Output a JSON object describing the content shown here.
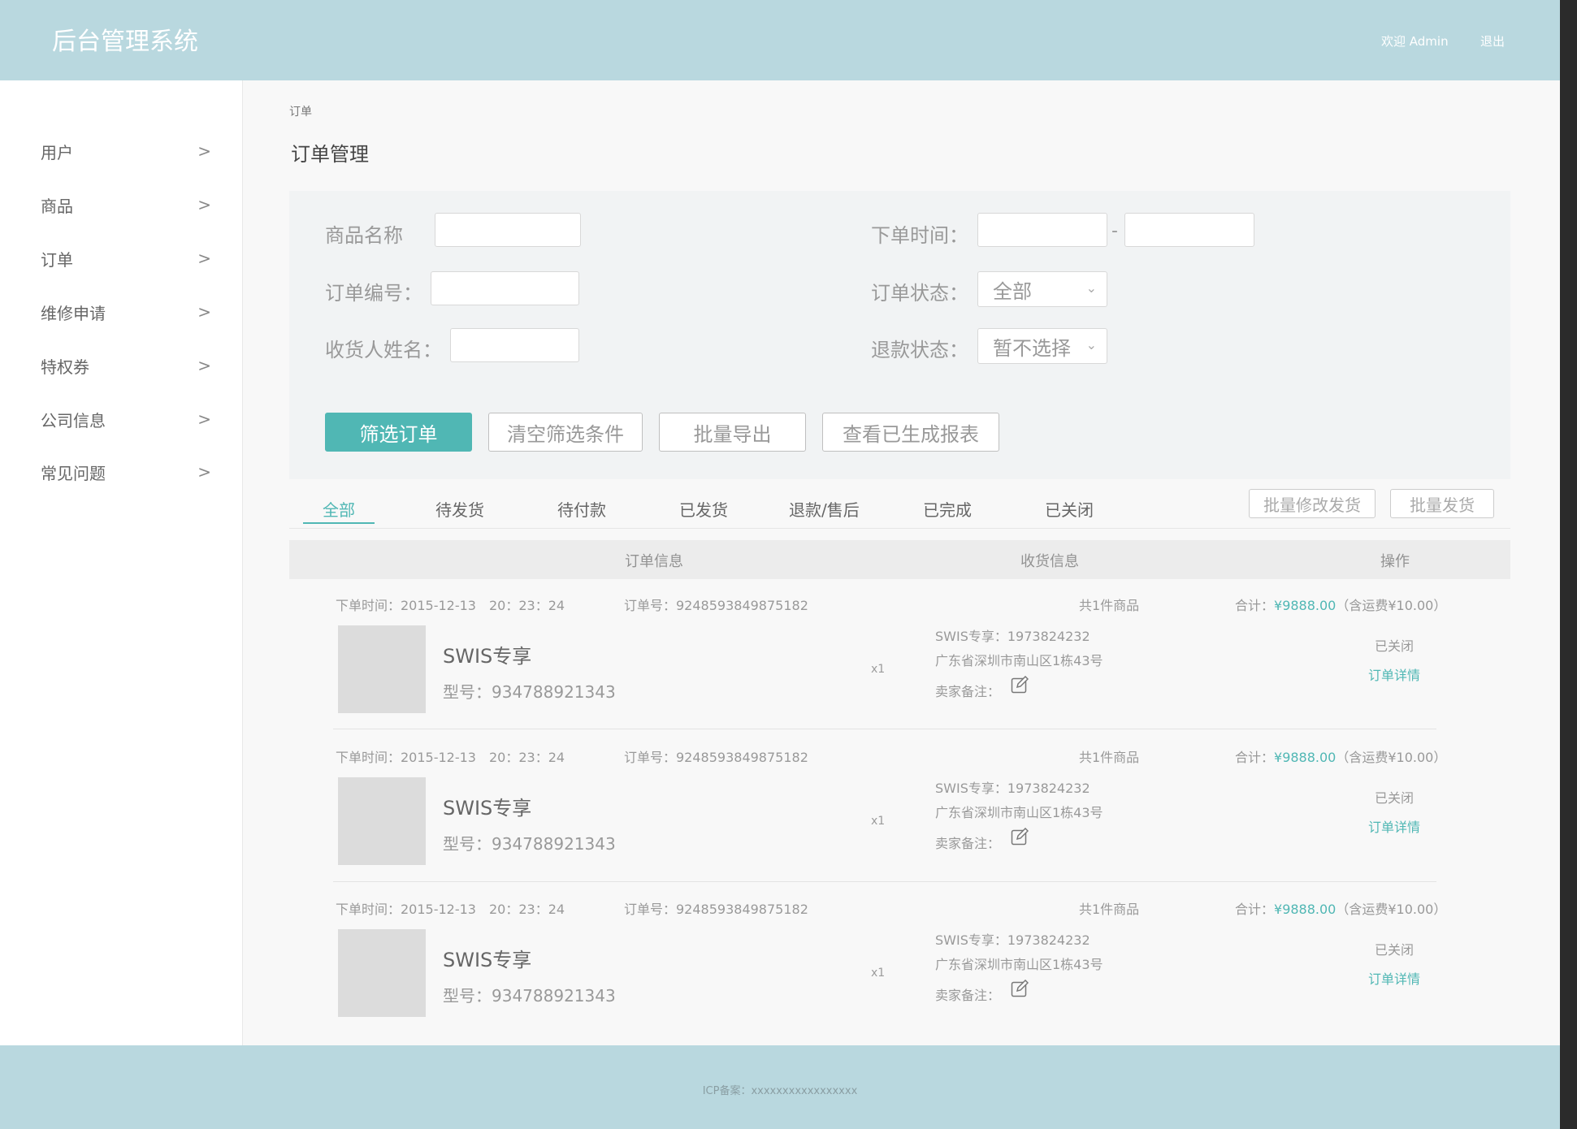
{
  "header": {
    "brand": "后台管理系统",
    "welcome": "欢迎 Admin",
    "logout": "退出"
  },
  "sidebar": {
    "items": [
      {
        "label": "用户"
      },
      {
        "label": "商品"
      },
      {
        "label": "订单"
      },
      {
        "label": "维修申请"
      },
      {
        "label": "特权券"
      },
      {
        "label": "公司信息"
      },
      {
        "label": "常见问题"
      }
    ],
    "chevron": ">"
  },
  "breadcrumb": "订单",
  "page_title": "订单管理",
  "filters": {
    "product_name_label": "商品名称",
    "order_time_label": "下单时间：",
    "date_separator": "-",
    "order_no_label": "订单编号：",
    "order_status_label": "订单状态：",
    "order_status_value": "全部",
    "receiver_label": "收货人姓名：",
    "refund_status_label": "退款状态：",
    "refund_status_value": "暂不选择"
  },
  "actions": {
    "filter": "筛选订单",
    "clear": "清空筛选条件",
    "export": "批量导出",
    "reports": "查看已生成报表"
  },
  "tabs": [
    "全部",
    "待发货",
    "待付款",
    "已发货",
    "退款/售后",
    "已完成",
    "已关闭"
  ],
  "tab_buttons": {
    "batch_modify": "批量修改发货",
    "batch_ship": "批量发货"
  },
  "table_header": {
    "info": "订单信息",
    "receiver": "收货信息",
    "action": "操作"
  },
  "orders": [
    {
      "time": "下单时间：2015-12-13　20：23：24",
      "order_no": "订单号：9248593849875182",
      "count": "共1件商品",
      "total_label": "合计：",
      "total": "¥9888.00",
      "shipping": "（含运费¥10.00）",
      "product": "SWIS专享",
      "model": "型号：934788921343",
      "qty": "x1",
      "receiver": "SWIS专享：1973824232",
      "address": "广东省深圳市南山区1栋43号",
      "remark": "卖家备注：",
      "status": "已关闭",
      "detail": "订单详情"
    },
    {
      "time": "下单时间：2015-12-13　20：23：24",
      "order_no": "订单号：9248593849875182",
      "count": "共1件商品",
      "total_label": "合计：",
      "total": "¥9888.00",
      "shipping": "（含运费¥10.00）",
      "product": "SWIS专享",
      "model": "型号：934788921343",
      "qty": "x1",
      "receiver": "SWIS专享：1973824232",
      "address": "广东省深圳市南山区1栋43号",
      "remark": "卖家备注：",
      "status": "已关闭",
      "detail": "订单详情"
    },
    {
      "time": "下单时间：2015-12-13　20：23：24",
      "order_no": "订单号：9248593849875182",
      "count": "共1件商品",
      "total_label": "合计：",
      "total": "¥9888.00",
      "shipping": "（含运费¥10.00）",
      "product": "SWIS专享",
      "model": "型号：934788921343",
      "qty": "x1",
      "receiver": "SWIS专享：1973824232",
      "address": "广东省深圳市南山区1栋43号",
      "remark": "卖家备注：",
      "status": "已关闭",
      "detail": "订单详情"
    }
  ],
  "footer": {
    "icp": "ICP备案：xxxxxxxxxxxxxxxxx"
  },
  "colors": {
    "header": "#b9d8df",
    "accent": "#50b7b4",
    "panel": "#f8f8f8"
  }
}
